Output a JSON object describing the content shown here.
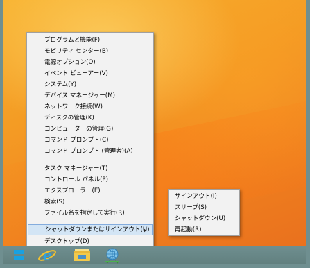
{
  "context_menu": {
    "items": [
      {
        "label": "プログラムと機能(F)"
      },
      {
        "label": "モビリティ センター(B)"
      },
      {
        "label": "電源オプション(O)"
      },
      {
        "label": "イベント ビューアー(V)"
      },
      {
        "label": "システム(Y)"
      },
      {
        "label": "デバイス マネージャー(M)"
      },
      {
        "label": "ネットワーク接続(W)"
      },
      {
        "label": "ディスクの管理(K)"
      },
      {
        "label": "コンピューターの管理(G)"
      },
      {
        "label": "コマンド プロンプト(C)"
      },
      {
        "label": "コマンド プロンプト (管理者)(A)"
      },
      {
        "label": "タスク マネージャー(T)"
      },
      {
        "label": "コントロール パネル(P)"
      },
      {
        "label": "エクスプローラー(E)"
      },
      {
        "label": "検索(S)"
      },
      {
        "label": "ファイル名を指定して実行(R)"
      },
      {
        "label": "シャットダウンまたはサインアウト(U)"
      },
      {
        "label": "デスクトップ(D)"
      }
    ],
    "selected_item": "シャットダウンまたはサインアウト(U)"
  },
  "submenu": {
    "items": [
      {
        "label": "サインアウト(I)"
      },
      {
        "label": "スリープ(S)"
      },
      {
        "label": "シャットダウン(U)"
      },
      {
        "label": "再起動(R)"
      }
    ]
  },
  "taskbar": {
    "items": [
      {
        "icon": "windows-logo-icon"
      },
      {
        "icon": "internet-explorer-icon"
      },
      {
        "icon": "file-explorer-icon"
      },
      {
        "icon": "network-globe-icon"
      }
    ]
  },
  "colors": {
    "selection_fill": "#d3e5f5",
    "selection_border": "#84acdd",
    "menu_background": "#f2f2f2",
    "taskbar": "#6f8f90",
    "accent_blue": "#1aa1e1"
  }
}
